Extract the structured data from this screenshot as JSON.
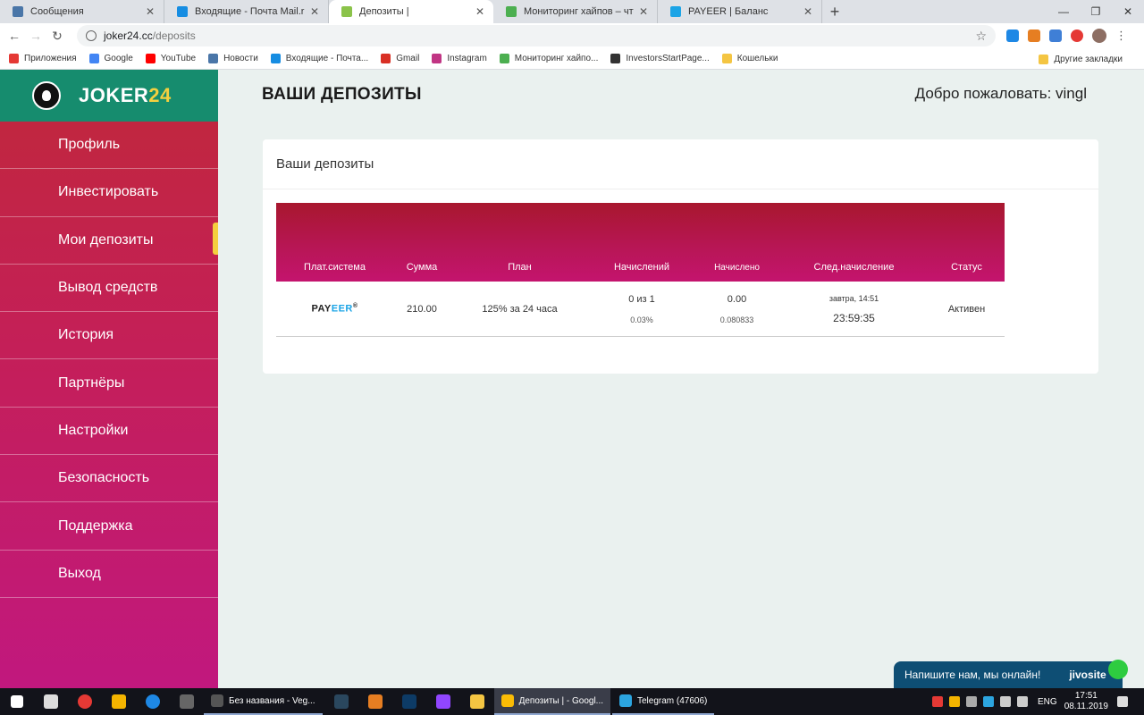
{
  "browser": {
    "tabs": [
      {
        "title": "Сообщения",
        "color": "#4a76a8",
        "active": false
      },
      {
        "title": "Входящие - Почта Mail.ru",
        "color": "#168de2",
        "active": false
      },
      {
        "title": "Депозиты |",
        "color": "#8bc34a",
        "active": true
      },
      {
        "title": "Мониторинг хайпов – что это и",
        "color": "#4caf50",
        "active": false
      },
      {
        "title": "PAYEER | Баланс",
        "color": "#1ba4e6",
        "active": false
      }
    ],
    "new_tab": "+",
    "url_host": "joker24.cc",
    "url_path": "/deposits",
    "bookmarks": [
      {
        "label": "Приложения",
        "color": "#e53935"
      },
      {
        "label": "Google",
        "color": "#4285f4"
      },
      {
        "label": "YouTube",
        "color": "#ff0000"
      },
      {
        "label": "Новости",
        "color": "#4a76a8"
      },
      {
        "label": "Входящие - Почта...",
        "color": "#168de2"
      },
      {
        "label": "Gmail",
        "color": "#d93025"
      },
      {
        "label": "Instagram",
        "color": "#c13584"
      },
      {
        "label": "Мониторинг хайпо...",
        "color": "#4caf50"
      },
      {
        "label": "InvestorsStartPage...",
        "color": "#333333"
      },
      {
        "label": "Кошельки",
        "color": "#f4c542"
      }
    ],
    "other_bookmarks": "Другие закладки"
  },
  "sidebar": {
    "brand_text": "JOKER",
    "brand_num": "24",
    "items": [
      {
        "label": "Профиль"
      },
      {
        "label": "Инвестировать"
      },
      {
        "label": "Мои депозиты"
      },
      {
        "label": "Вывод средств"
      },
      {
        "label": "История"
      },
      {
        "label": "Партнёры"
      },
      {
        "label": "Настройки"
      },
      {
        "label": "Безопасность"
      },
      {
        "label": "Поддержка"
      },
      {
        "label": "Выход"
      }
    ],
    "active_index": 2
  },
  "main": {
    "title": "ВАШИ ДЕПОЗИТЫ",
    "welcome": "Добро пожаловать: vingl",
    "card_title": "Ваши депозиты",
    "columns": [
      "Плат.система",
      "Сумма",
      "План",
      "Начислений",
      "Начислено",
      "След.начисление",
      "Статус"
    ],
    "row": {
      "system_logo_a": "PAY",
      "system_logo_b": "EER",
      "system_logo_c": "®",
      "amount": "210.00",
      "plan": "125% за 24 часа",
      "accruals": "0 из 1",
      "accruals_pct": "0.03%",
      "accrued": "0.00",
      "accrued_sub": "0.080833",
      "next_date": "завтра, 14:51",
      "next_timer": "23:59:35",
      "status": "Активен"
    }
  },
  "jivo": {
    "text": "Напишите нам, мы онлайн!",
    "brand": "jivosite"
  },
  "taskbar": {
    "apps": [
      {
        "label": "Без названия - Veg...",
        "color": "#555555",
        "active": false
      },
      {
        "label": "Депозиты | - Googl...",
        "color": "#fbbc05",
        "active": true
      },
      {
        "label": "Telegram (47606)",
        "color": "#2ca5e0",
        "active": false
      }
    ],
    "lang": "ENG",
    "time": "17:51",
    "date": "08.11.2019"
  }
}
